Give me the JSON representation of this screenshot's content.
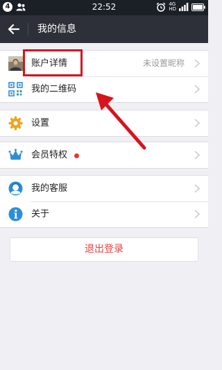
{
  "status_bar": {
    "notification_count": "4",
    "time": "22:52",
    "network": "4G",
    "network_sub": "HD"
  },
  "header": {
    "title": "我的信息"
  },
  "sections": {
    "profile": [
      {
        "label": "账户详情",
        "value": "未设置昵称",
        "icon": "avatar-icon"
      },
      {
        "label": "我的二维码",
        "value": "",
        "icon": "qr-code-icon"
      }
    ],
    "settings": [
      {
        "label": "设置",
        "icon": "gear-icon"
      }
    ],
    "membership": [
      {
        "label": "会员特权",
        "icon": "crown-icon",
        "badge": "red-dot"
      }
    ],
    "support": [
      {
        "label": "我的客服",
        "icon": "customer-service-icon"
      },
      {
        "label": "关于",
        "icon": "info-icon"
      }
    ]
  },
  "logout": {
    "label": "退出登录"
  },
  "colors": {
    "status_bar": "#1b1f26",
    "title_bar": "#2d3038",
    "background": "#efeff4",
    "logout_text": "#e64340",
    "annotation_red": "#d9121b"
  }
}
